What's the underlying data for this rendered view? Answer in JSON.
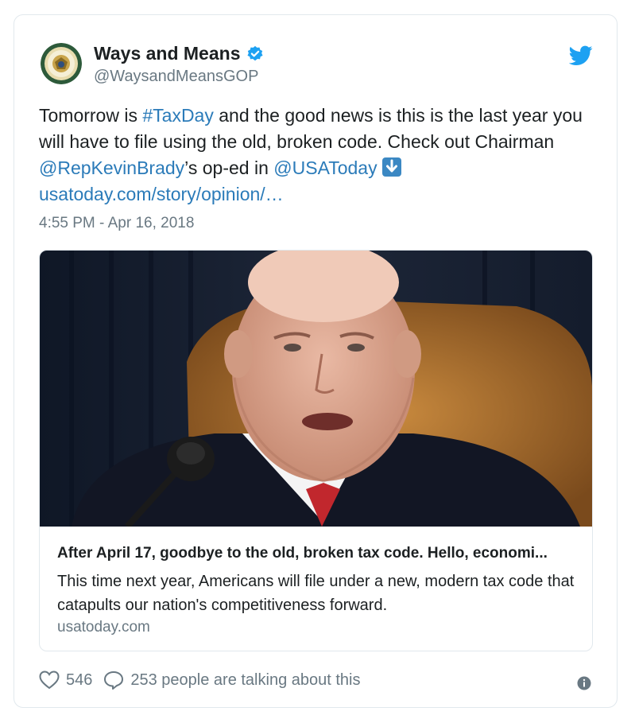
{
  "author": {
    "display_name": "Ways and Means",
    "handle": "@WaysandMeansGOP",
    "verified": true,
    "avatar_icon": "house-ways-and-means-seal"
  },
  "tweet": {
    "text_1": "Tomorrow is ",
    "hashtag": "#TaxDay",
    "text_2": " and the good news is this is the last year you will have to file using the old, broken code. Check out Chairman ",
    "mention_1": "@RepKevinBrady",
    "text_3": "’s op-ed in ",
    "mention_2": "@USAToday",
    "emoji_icon": "down-arrow-emoji",
    "link": "usatoday.com/story/opinion/…",
    "timestamp": "4:55 PM - Apr 16, 2018"
  },
  "card": {
    "image_icon": "speaker-photo",
    "title": "After April 17, goodbye to the old, broken tax code. Hello, economi...",
    "description": "This time next year, Americans will file under a new, modern tax code that catapults our nation's competitiveness forward.",
    "domain": "usatoday.com"
  },
  "actions": {
    "likes": "546",
    "talking": "253 people are talking about this"
  },
  "colors": {
    "link": "#2b7bb9",
    "muted": "#697882",
    "twitter_blue": "#1da1f2"
  }
}
